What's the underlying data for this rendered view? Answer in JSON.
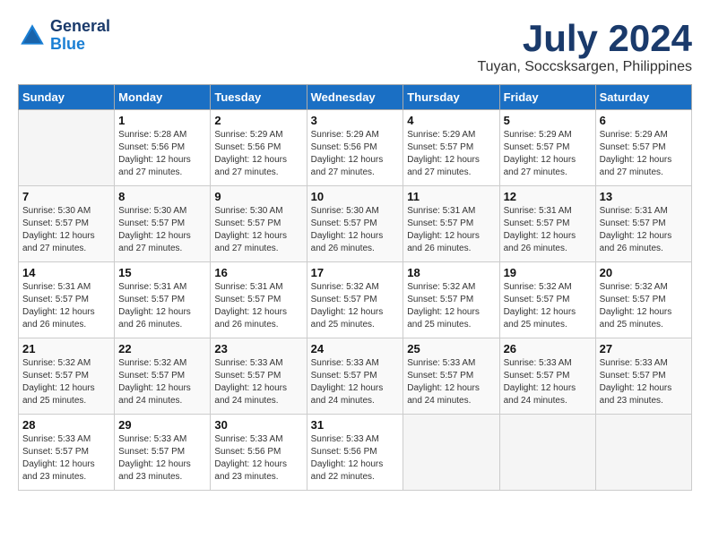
{
  "logo": {
    "line1": "General",
    "line2": "Blue"
  },
  "title": "July 2024",
  "subtitle": "Tuyan, Soccsksargen, Philippines",
  "weekdays": [
    "Sunday",
    "Monday",
    "Tuesday",
    "Wednesday",
    "Thursday",
    "Friday",
    "Saturday"
  ],
  "weeks": [
    [
      {
        "day": "",
        "info": ""
      },
      {
        "day": "1",
        "info": "Sunrise: 5:28 AM\nSunset: 5:56 PM\nDaylight: 12 hours\nand 27 minutes."
      },
      {
        "day": "2",
        "info": "Sunrise: 5:29 AM\nSunset: 5:56 PM\nDaylight: 12 hours\nand 27 minutes."
      },
      {
        "day": "3",
        "info": "Sunrise: 5:29 AM\nSunset: 5:56 PM\nDaylight: 12 hours\nand 27 minutes."
      },
      {
        "day": "4",
        "info": "Sunrise: 5:29 AM\nSunset: 5:57 PM\nDaylight: 12 hours\nand 27 minutes."
      },
      {
        "day": "5",
        "info": "Sunrise: 5:29 AM\nSunset: 5:57 PM\nDaylight: 12 hours\nand 27 minutes."
      },
      {
        "day": "6",
        "info": "Sunrise: 5:29 AM\nSunset: 5:57 PM\nDaylight: 12 hours\nand 27 minutes."
      }
    ],
    [
      {
        "day": "7",
        "info": "Sunrise: 5:30 AM\nSunset: 5:57 PM\nDaylight: 12 hours\nand 27 minutes."
      },
      {
        "day": "8",
        "info": "Sunrise: 5:30 AM\nSunset: 5:57 PM\nDaylight: 12 hours\nand 27 minutes."
      },
      {
        "day": "9",
        "info": "Sunrise: 5:30 AM\nSunset: 5:57 PM\nDaylight: 12 hours\nand 27 minutes."
      },
      {
        "day": "10",
        "info": "Sunrise: 5:30 AM\nSunset: 5:57 PM\nDaylight: 12 hours\nand 26 minutes."
      },
      {
        "day": "11",
        "info": "Sunrise: 5:31 AM\nSunset: 5:57 PM\nDaylight: 12 hours\nand 26 minutes."
      },
      {
        "day": "12",
        "info": "Sunrise: 5:31 AM\nSunset: 5:57 PM\nDaylight: 12 hours\nand 26 minutes."
      },
      {
        "day": "13",
        "info": "Sunrise: 5:31 AM\nSunset: 5:57 PM\nDaylight: 12 hours\nand 26 minutes."
      }
    ],
    [
      {
        "day": "14",
        "info": "Sunrise: 5:31 AM\nSunset: 5:57 PM\nDaylight: 12 hours\nand 26 minutes."
      },
      {
        "day": "15",
        "info": "Sunrise: 5:31 AM\nSunset: 5:57 PM\nDaylight: 12 hours\nand 26 minutes."
      },
      {
        "day": "16",
        "info": "Sunrise: 5:31 AM\nSunset: 5:57 PM\nDaylight: 12 hours\nand 26 minutes."
      },
      {
        "day": "17",
        "info": "Sunrise: 5:32 AM\nSunset: 5:57 PM\nDaylight: 12 hours\nand 25 minutes."
      },
      {
        "day": "18",
        "info": "Sunrise: 5:32 AM\nSunset: 5:57 PM\nDaylight: 12 hours\nand 25 minutes."
      },
      {
        "day": "19",
        "info": "Sunrise: 5:32 AM\nSunset: 5:57 PM\nDaylight: 12 hours\nand 25 minutes."
      },
      {
        "day": "20",
        "info": "Sunrise: 5:32 AM\nSunset: 5:57 PM\nDaylight: 12 hours\nand 25 minutes."
      }
    ],
    [
      {
        "day": "21",
        "info": "Sunrise: 5:32 AM\nSunset: 5:57 PM\nDaylight: 12 hours\nand 25 minutes."
      },
      {
        "day": "22",
        "info": "Sunrise: 5:32 AM\nSunset: 5:57 PM\nDaylight: 12 hours\nand 24 minutes."
      },
      {
        "day": "23",
        "info": "Sunrise: 5:33 AM\nSunset: 5:57 PM\nDaylight: 12 hours\nand 24 minutes."
      },
      {
        "day": "24",
        "info": "Sunrise: 5:33 AM\nSunset: 5:57 PM\nDaylight: 12 hours\nand 24 minutes."
      },
      {
        "day": "25",
        "info": "Sunrise: 5:33 AM\nSunset: 5:57 PM\nDaylight: 12 hours\nand 24 minutes."
      },
      {
        "day": "26",
        "info": "Sunrise: 5:33 AM\nSunset: 5:57 PM\nDaylight: 12 hours\nand 24 minutes."
      },
      {
        "day": "27",
        "info": "Sunrise: 5:33 AM\nSunset: 5:57 PM\nDaylight: 12 hours\nand 23 minutes."
      }
    ],
    [
      {
        "day": "28",
        "info": "Sunrise: 5:33 AM\nSunset: 5:57 PM\nDaylight: 12 hours\nand 23 minutes."
      },
      {
        "day": "29",
        "info": "Sunrise: 5:33 AM\nSunset: 5:57 PM\nDaylight: 12 hours\nand 23 minutes."
      },
      {
        "day": "30",
        "info": "Sunrise: 5:33 AM\nSunset: 5:56 PM\nDaylight: 12 hours\nand 23 minutes."
      },
      {
        "day": "31",
        "info": "Sunrise: 5:33 AM\nSunset: 5:56 PM\nDaylight: 12 hours\nand 22 minutes."
      },
      {
        "day": "",
        "info": ""
      },
      {
        "day": "",
        "info": ""
      },
      {
        "day": "",
        "info": ""
      }
    ]
  ]
}
